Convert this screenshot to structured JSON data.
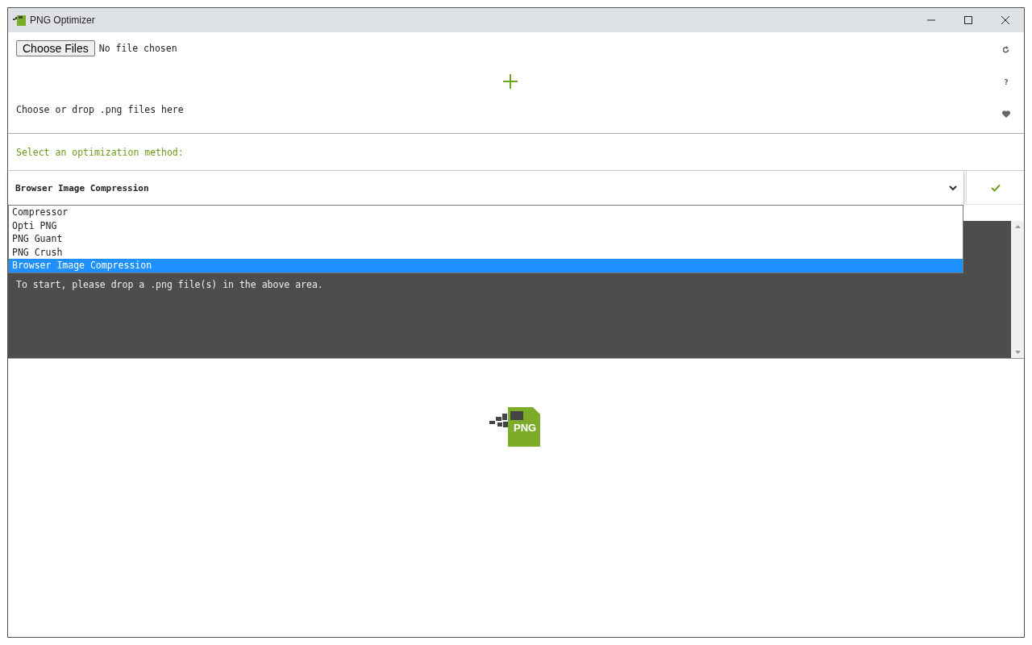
{
  "window": {
    "title": "PNG Optimizer"
  },
  "file_input": {
    "button": "Choose Files",
    "status": "No file chosen"
  },
  "drop_zone": {
    "hint": "Choose or drop .png files here"
  },
  "side_tools": {
    "help": "?"
  },
  "method": {
    "label": "Select an optimization method:",
    "value": "Browser Image Compression",
    "expanded": true,
    "options": [
      {
        "label": "Compressor",
        "selected": false
      },
      {
        "label": "Opti PNG",
        "selected": false
      },
      {
        "label": "PNG Guant",
        "selected": false
      },
      {
        "label": "PNG Crush",
        "selected": false
      },
      {
        "label": "Browser Image Compression",
        "selected": true
      }
    ]
  },
  "log": {
    "text": "To start, please drop a .png file(s) in the above area."
  },
  "logo": {
    "text": "PNG"
  }
}
